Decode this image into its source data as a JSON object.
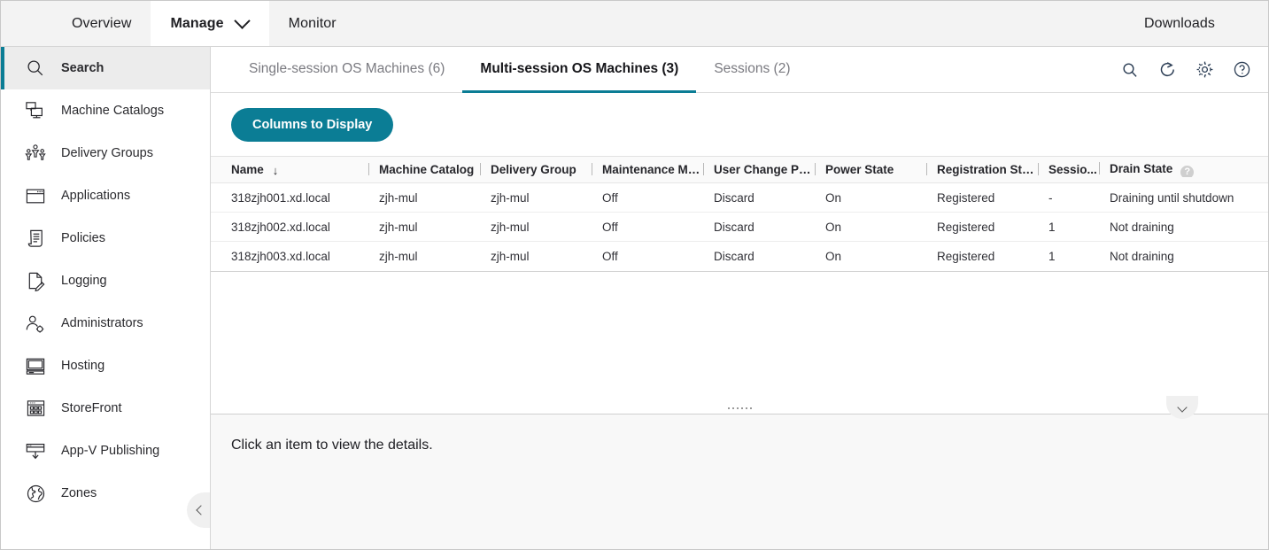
{
  "topnav": {
    "items": [
      {
        "label": "Overview",
        "active": false,
        "caret": false
      },
      {
        "label": "Manage",
        "active": true,
        "caret": true
      },
      {
        "label": "Monitor",
        "active": false,
        "caret": false
      }
    ],
    "downloads_label": "Downloads"
  },
  "sidebar": {
    "items": [
      {
        "label": "Search",
        "icon": "search-icon",
        "active": true
      },
      {
        "label": "Machine Catalogs",
        "icon": "machine-catalogs-icon",
        "active": false
      },
      {
        "label": "Delivery Groups",
        "icon": "delivery-groups-icon",
        "active": false
      },
      {
        "label": "Applications",
        "icon": "applications-icon",
        "active": false
      },
      {
        "label": "Policies",
        "icon": "policies-icon",
        "active": false
      },
      {
        "label": "Logging",
        "icon": "logging-icon",
        "active": false
      },
      {
        "label": "Administrators",
        "icon": "administrators-icon",
        "active": false
      },
      {
        "label": "Hosting",
        "icon": "hosting-icon",
        "active": false
      },
      {
        "label": "StoreFront",
        "icon": "storefront-icon",
        "active": false
      },
      {
        "label": "App-V Publishing",
        "icon": "app-v-publishing-icon",
        "active": false
      },
      {
        "label": "Zones",
        "icon": "zones-icon",
        "active": false
      }
    ],
    "collapse_icon": "chevron-left-icon"
  },
  "tabs": {
    "items": [
      {
        "label": "Single-session OS Machines (6)",
        "active": false
      },
      {
        "label": "Multi-session OS Machines (3)",
        "active": true
      },
      {
        "label": "Sessions (2)",
        "active": false
      }
    ],
    "icons": [
      {
        "name": "search-icon"
      },
      {
        "name": "refresh-icon"
      },
      {
        "name": "gear-icon"
      },
      {
        "name": "help-icon"
      }
    ]
  },
  "toolbar": {
    "columns_to_display_label": "Columns to Display"
  },
  "table": {
    "columns": [
      "Name",
      "Machine Catalog",
      "Delivery Group",
      "Maintenance Mode",
      "User Change Per...",
      "Power State",
      "Registration State",
      "Sessio...",
      "Drain State"
    ],
    "sort_column": "Name",
    "sort_arrow": "↓",
    "drain_state_help_glyph": "?",
    "rows": [
      {
        "name": "318zjh001.xd.local",
        "machine_catalog": "zjh-mul",
        "delivery_group": "zjh-mul",
        "maintenance_mode": "Off",
        "user_change_persistence": "Discard",
        "power_state": "On",
        "registration_state": "Registered",
        "sessions": "-",
        "drain_state": "Draining until shutdown"
      },
      {
        "name": "318zjh002.xd.local",
        "machine_catalog": "zjh-mul",
        "delivery_group": "zjh-mul",
        "maintenance_mode": "Off",
        "user_change_persistence": "Discard",
        "power_state": "On",
        "registration_state": "Registered",
        "sessions": "1",
        "drain_state": "Not draining"
      },
      {
        "name": "318zjh003.xd.local",
        "machine_catalog": "zjh-mul",
        "delivery_group": "zjh-mul",
        "maintenance_mode": "Off",
        "user_change_persistence": "Discard",
        "power_state": "On",
        "registration_state": "Registered",
        "sessions": "1",
        "drain_state": "Not draining"
      }
    ]
  },
  "details": {
    "placeholder_text": "Click an item to view the details.",
    "toggle_icon": "chevron-down-icon"
  },
  "colors": {
    "accent_teal": "#0b7d95",
    "header_bg": "#f3f3f3",
    "sidebar_active_bg": "#ececec",
    "details_bg": "#f8f8f8",
    "text_primary": "#1f1f23",
    "text_muted": "#7a7a80"
  }
}
